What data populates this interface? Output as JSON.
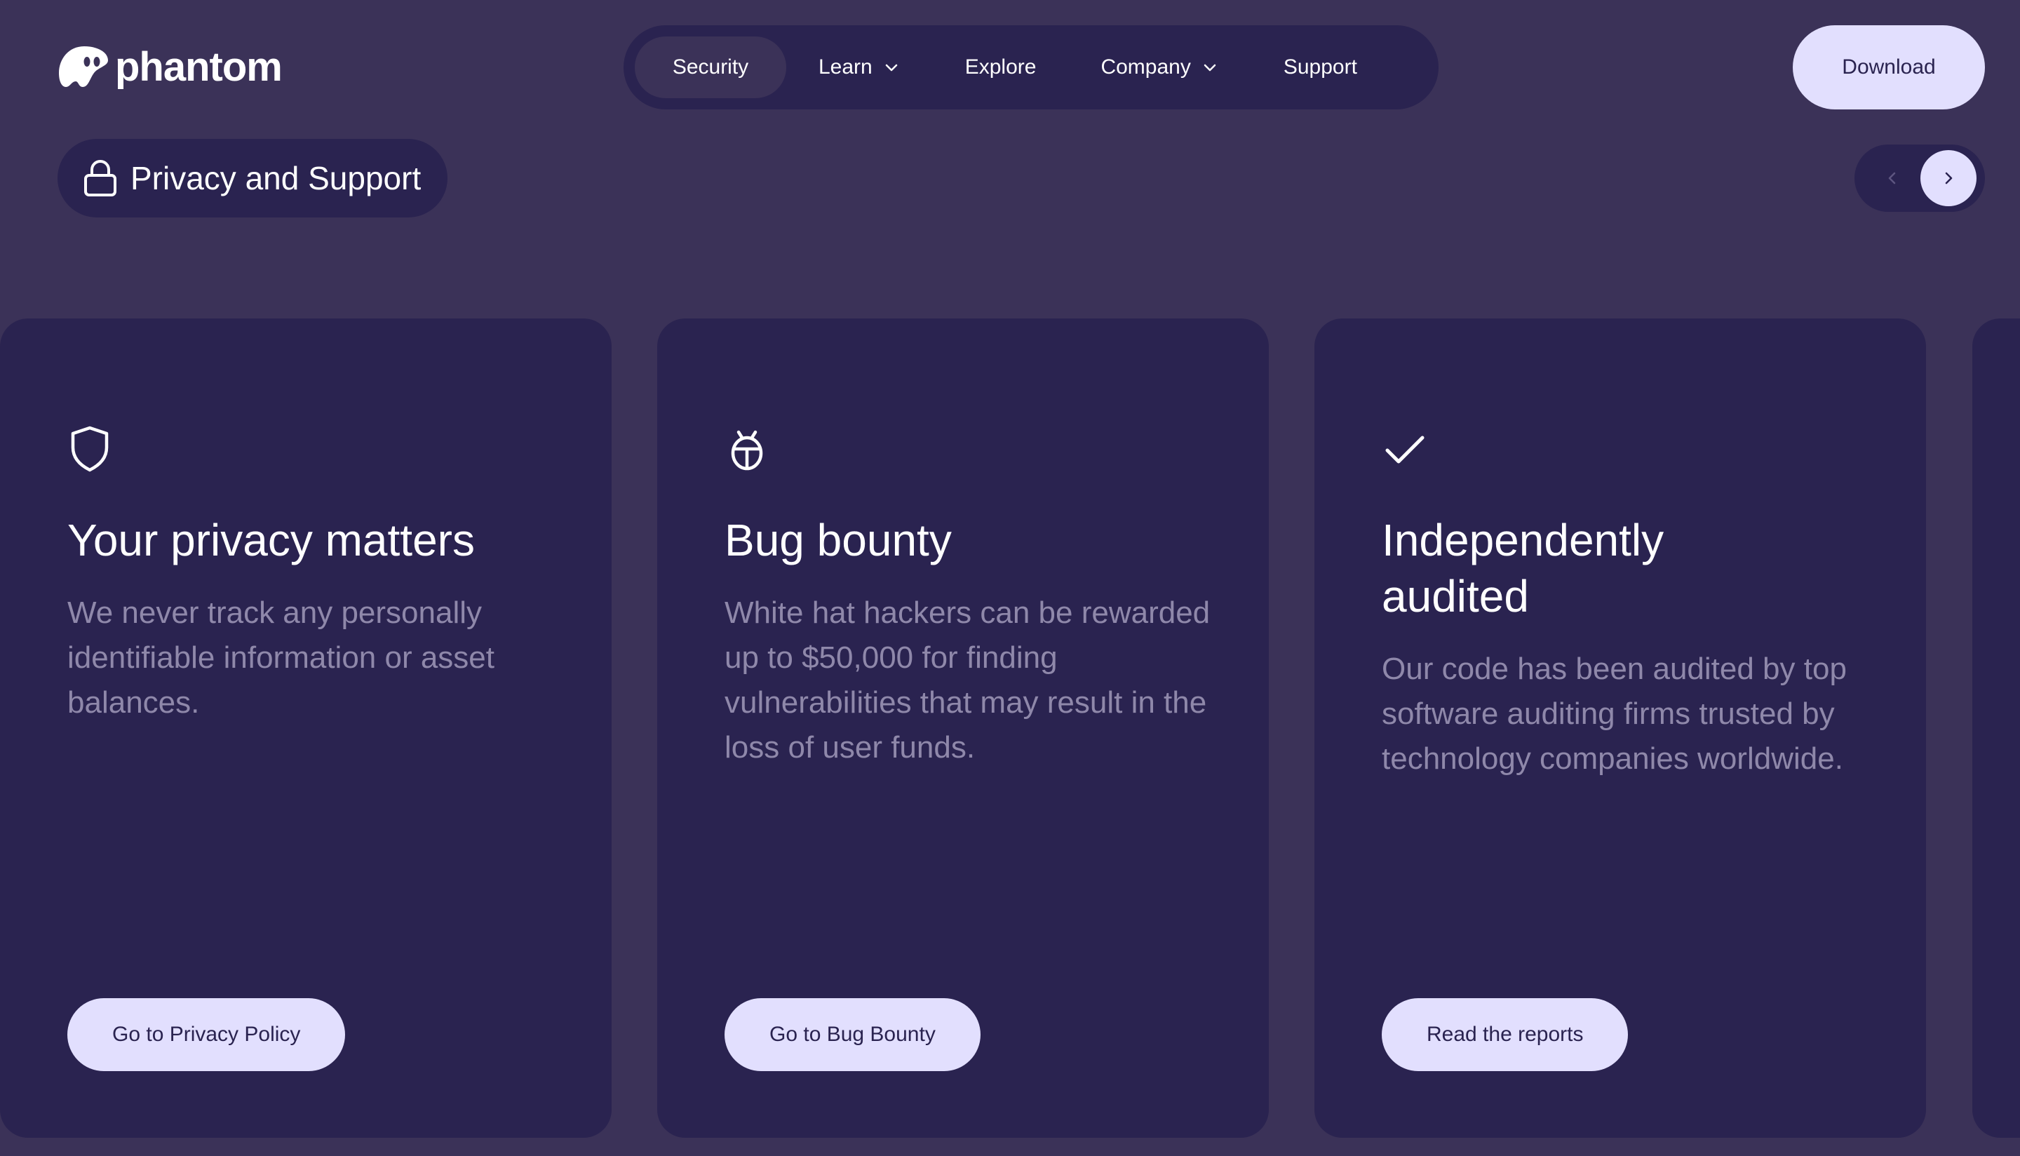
{
  "brand": {
    "name": "phantom"
  },
  "nav": {
    "items": [
      {
        "label": "Security",
        "active": true
      },
      {
        "label": "Learn",
        "has_dropdown": true
      },
      {
        "label": "Explore"
      },
      {
        "label": "Company",
        "has_dropdown": true
      },
      {
        "label": "Support"
      }
    ]
  },
  "header": {
    "download_label": "Download"
  },
  "section": {
    "title": "Privacy and Support",
    "icon": "lock-icon"
  },
  "carousel": {
    "prev_icon": "chevron-left-icon",
    "next_icon": "chevron-right-icon"
  },
  "cards": [
    {
      "icon": "shield-icon",
      "title": "Your privacy matters",
      "text": "We never track any personally identifiable information or asset balances.",
      "button": "Go to Privacy Policy"
    },
    {
      "icon": "bug-icon",
      "title": "Bug bounty",
      "text": "White hat hackers can be rewarded up to $50,000 for finding vulnerabilities that may result in the loss of user funds.",
      "button": "Go to Bug Bounty"
    },
    {
      "icon": "checkmark-icon",
      "title": "Independently audited",
      "text": "Our code has been audited by top software auditing firms trusted by technology companies worldwide.",
      "button": "Read the reports"
    }
  ],
  "colors": {
    "page_bg": "#3b3258",
    "card_bg": "#2a2350",
    "accent_light": "#e2dffe",
    "muted_text": "#8f88aa"
  }
}
